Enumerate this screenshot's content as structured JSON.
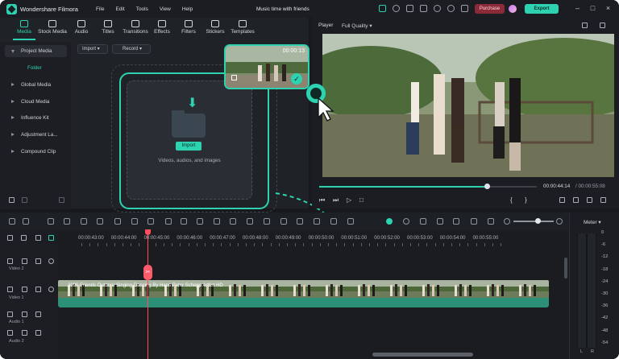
{
  "app": {
    "name": "Wondershare Filmora",
    "project_title": "Music time with friends"
  },
  "menu": [
    "File",
    "Edit",
    "Tools",
    "View",
    "Help"
  ],
  "header_actions": {
    "purchase": "Purchase",
    "export": "Export"
  },
  "media_tabs": [
    "Media",
    "Stock Media",
    "Audio",
    "Titles",
    "Transitions",
    "Effects",
    "Filters",
    "Stickers",
    "Templates"
  ],
  "sidebar": {
    "items": [
      "Project Media",
      "Folder",
      "Global Media",
      "Cloud Media",
      "Influence Kit",
      "Adjustment La...",
      "Compound Clip"
    ]
  },
  "media_toolbar": {
    "import": "Import",
    "record": "Record"
  },
  "import_area": {
    "button": "Import",
    "hint": "Videos, audios, and images"
  },
  "thumbnail": {
    "duration": "00:00:13"
  },
  "player": {
    "label": "Player",
    "quality": "Full Quality",
    "current_time": "00:00:44:14",
    "total_time": "/ 00:00:55:08",
    "progress": 0.77
  },
  "timeline": {
    "ruler": [
      "00:00:43:00",
      "00:00:44:00",
      "00:00:45:00",
      "00:00:46:00",
      "00:00:47:00",
      "00:00:48:00",
      "00:00:49:00",
      "00:00:50:00",
      "00:00:51:00",
      "00:00:52:00",
      "00:00:53:00",
      "00:00:54:00",
      "00:00:55:00"
    ],
    "tracks": [
      "Video 2",
      "Video 1",
      "Audio 1",
      "Audio 2"
    ],
    "clip_title": "2096 Friends Outdoor Singing Dancing By Hans Peter Schepp Artlist HD",
    "zoom": 0.6
  },
  "meter": {
    "title": "Meter",
    "scale": [
      "0",
      "-6",
      "-12",
      "-18",
      "-24",
      "-30",
      "-36",
      "-42",
      "-48",
      "-54"
    ],
    "channels": [
      "L",
      "R"
    ]
  },
  "colors": {
    "accent": "#2dd3b0",
    "playhead": "#ff4d5e",
    "purchase": "#8b2b3a"
  }
}
